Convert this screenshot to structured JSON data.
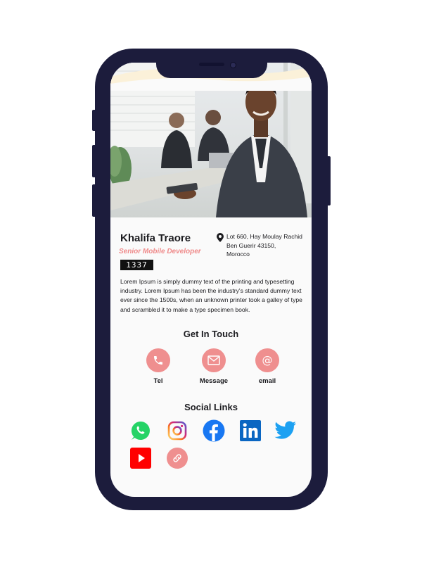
{
  "profile": {
    "name": "Khalifa Traore",
    "title": "Senior Mobile Developer",
    "badge": "1337",
    "address_line1": "Lot 660, Hay Moulay Rachid",
    "address_line2": "Ben Guerir 43150,",
    "address_line3": "Morocco",
    "bio": "Lorem Ipsum is simply dummy text of the printing and typesetting industry. Lorem Ipsum has been the industry's standard dummy text ever since the 1500s, when an unknown printer took a galley of type and scrambled it to make a type specimen book."
  },
  "contact": {
    "heading": "Get In Touch",
    "items": [
      {
        "label": "Tel",
        "icon": "phone-icon"
      },
      {
        "label": "Message",
        "icon": "envelope-icon"
      },
      {
        "label": "email",
        "icon": "at-sign-icon"
      }
    ]
  },
  "social": {
    "heading": "Social Links",
    "items": [
      {
        "icon": "whatsapp-icon"
      },
      {
        "icon": "instagram-icon"
      },
      {
        "icon": "facebook-icon"
      },
      {
        "icon": "linkedin-icon"
      },
      {
        "icon": "twitter-icon"
      },
      {
        "icon": "youtube-icon"
      },
      {
        "icon": "link-icon"
      }
    ]
  },
  "colors": {
    "frame": "#1c1c3c",
    "accent": "#ef8f8f",
    "wave": "#fbf1d9",
    "whatsapp": "#25d366",
    "facebook": "#1877f2",
    "linkedin": "#0a66c2",
    "twitter": "#1da1f2",
    "youtube": "#ff0000"
  }
}
